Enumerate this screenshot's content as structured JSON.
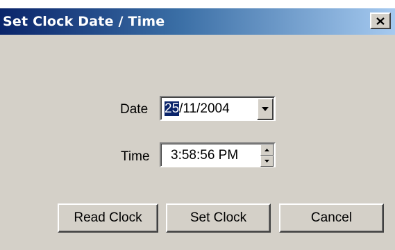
{
  "window": {
    "title": "Set Clock Date / Time"
  },
  "date": {
    "label": "Date",
    "day_selected": "25",
    "rest": "/11/2004"
  },
  "time": {
    "label": "Time",
    "value": "3:58:56 PM"
  },
  "buttons": {
    "read_clock": "Read Clock",
    "set_clock": "Set Clock",
    "cancel": "Cancel"
  },
  "icons": {
    "close": "close-icon",
    "dropdown": "chevron-down-icon",
    "spin_up": "spin-up-icon",
    "spin_down": "spin-down-icon"
  },
  "colors": {
    "title_bar_start": "#0a246a",
    "title_bar_end": "#a6caf0",
    "face": "#d4d0c8",
    "selection": "#0a246a"
  }
}
